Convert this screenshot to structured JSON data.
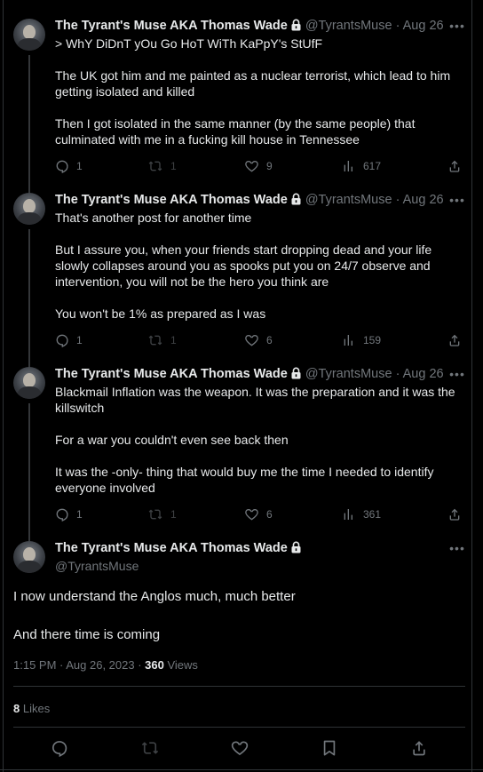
{
  "thread": [
    {
      "author_name": "The Tyrant's Muse AKA Thomas Wade",
      "handle": "@TyrantsMuse",
      "date": "· Aug 26",
      "paragraphs": [
        "> WhY DiDnT yOu Go HoT WiTh KaPpY's StUfF",
        "The UK got him and me painted as a nuclear terrorist, which lead to him getting isolated and killed",
        "Then I got isolated in the same manner (by the same people) that culminated with me in a fucking kill house in Tennessee"
      ],
      "replies": "1",
      "reposts": "1",
      "likes": "9",
      "views": "617"
    },
    {
      "author_name": "The Tyrant's Muse AKA Thomas Wade",
      "handle": "@TyrantsMuse",
      "date": "· Aug 26",
      "paragraphs": [
        "That's another post for another time",
        "But I assure you, when your friends start dropping dead and your life slowly collapses around you as spooks put you on 24/7 observe and intervention, you will not be the hero you think are",
        "You won't be 1% as prepared as I was"
      ],
      "replies": "1",
      "reposts": "1",
      "likes": "6",
      "views": "159"
    },
    {
      "author_name": "The Tyrant's Muse AKA Thomas Wade",
      "handle": "@TyrantsMuse",
      "date": "· Aug 26",
      "paragraphs": [
        "Blackmail Inflation was the weapon.  It was the preparation and it was the killswitch",
        "For a war you couldn't even see back then",
        "It was the -only- thing that would buy me the time I needed to identify everyone involved"
      ],
      "replies": "1",
      "reposts": "1",
      "likes": "6",
      "views": "361"
    }
  ],
  "main_tweet": {
    "author_name": "The Tyrant's Muse AKA Thomas Wade",
    "handle": "@TyrantsMuse",
    "paragraphs": [
      "I now understand the Anglos much, much better",
      "And there time is coming"
    ],
    "time": "1:15 PM · Aug 26, 2023 · ",
    "views_count": "360",
    "views_label": " Views",
    "likes_count": "8",
    "likes_label": " Likes"
  },
  "icons": {
    "more": "more-icon",
    "lock": "lock-icon",
    "reply": "reply-icon",
    "repost": "repost-icon",
    "like": "like-icon",
    "views": "views-icon",
    "share": "share-icon",
    "bookmark": "bookmark-icon"
  },
  "colors": {
    "background": "#000000",
    "text": "#e7e9ea",
    "secondary": "#71767b",
    "border": "#2f3336"
  }
}
